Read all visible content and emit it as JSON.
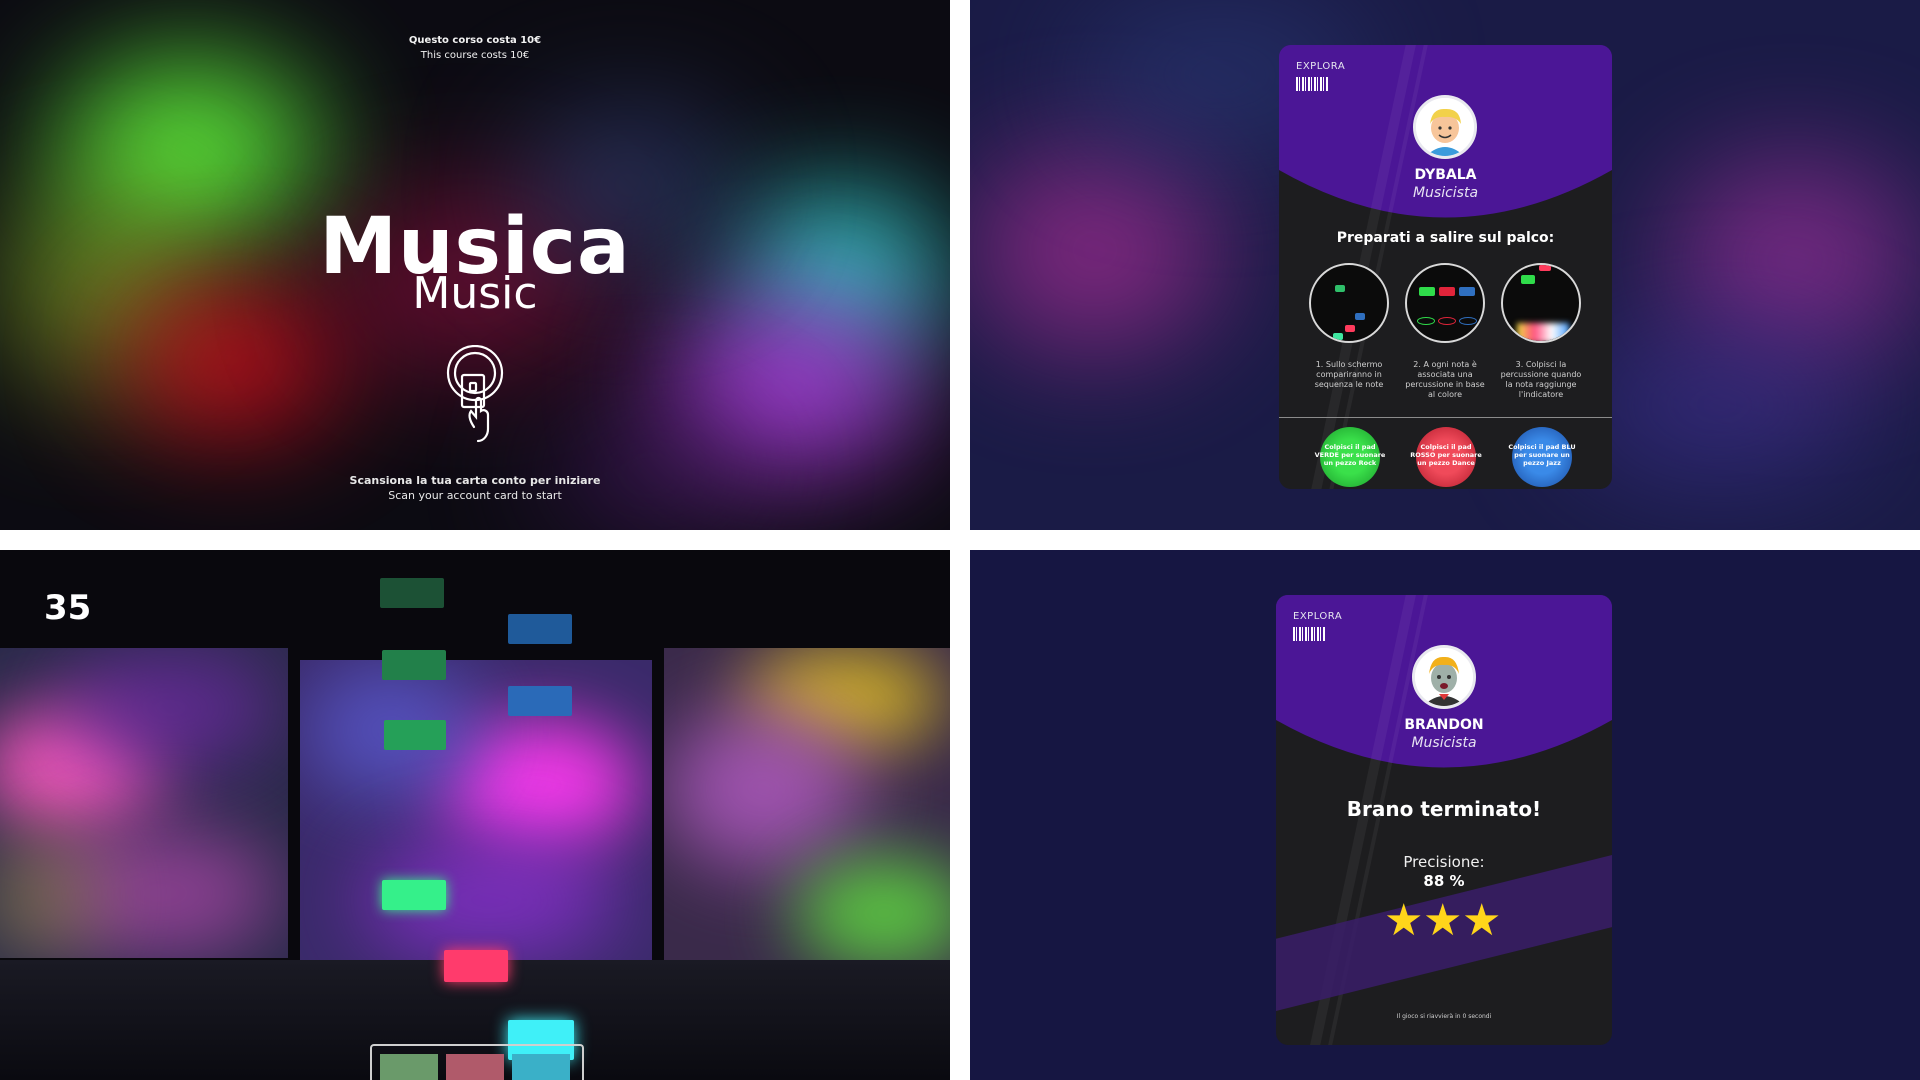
{
  "start_screen": {
    "price_it": "Questo corso costa 10€",
    "price_en": "This course costs 10€",
    "title_it": "Musica",
    "title_en": "Music",
    "icon": "tap-card-icon",
    "scan_it": "Scansiona la tua carta conto per iniziare",
    "scan_en": "Scan your account card to start"
  },
  "instructions_card": {
    "brand": "EXPLORA",
    "name": "DYBALA",
    "role": "Musicista",
    "heading": "Preparati a salire sul palco:",
    "steps": [
      "1. Sullo schermo compariranno in sequenza le note",
      "2. A ogni nota è associata una percussione in base al colore",
      "3. Colpisci la percussione quando la nota raggiunge l'indicatore"
    ],
    "pads": [
      {
        "text": "Colpisci il pad VERDE per suonare un pezzo Rock",
        "color": "#2ecc40"
      },
      {
        "text": "Colpisci il pad ROSSO per suonare un pezzo Dance",
        "color": "#e23a4a"
      },
      {
        "text": "Colpisci il pad BLU per suonare un pezzo Jazz",
        "color": "#2a78d8"
      }
    ]
  },
  "game_screen": {
    "score": "35",
    "note_colors": {
      "green": "#2fbf6a",
      "blue": "#2f6fbf",
      "red": "#ff3b5c",
      "cyan": "#3fe6f2"
    }
  },
  "result_card": {
    "brand": "EXPLORA",
    "name": "BRANDON",
    "role": "Musicista",
    "finish": "Brano terminato!",
    "precision_label": "Precisione:",
    "precision_value": "88 %",
    "stars": 3,
    "footer": "Il gioco si riavvierà in 0 secondi"
  }
}
